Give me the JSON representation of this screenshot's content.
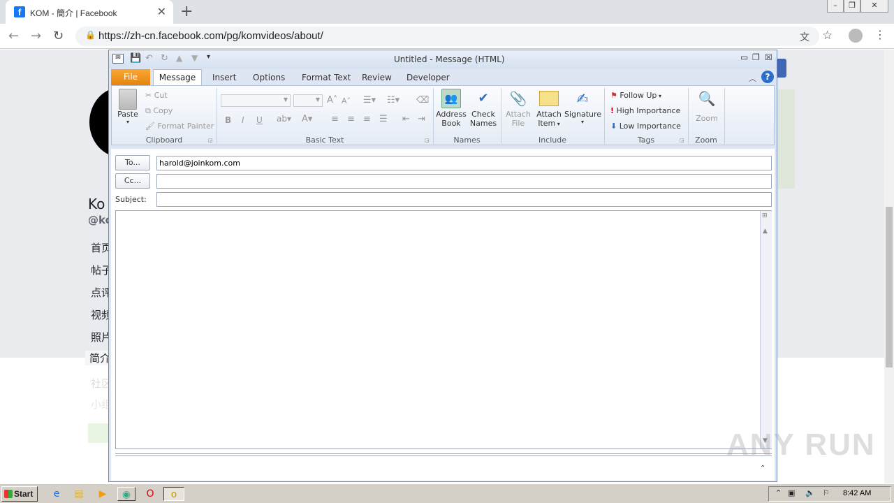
{
  "browser": {
    "tab_title": "KOM - 簡介 | Facebook",
    "tab_favicon": "f",
    "url": "https://zh-cn.facebook.com/pg/komvideos/about/"
  },
  "facebook": {
    "name_partial": "Ko",
    "handle_partial": "@ko",
    "nav": [
      "首页",
      "帖子",
      "点评",
      "视频",
      "照片",
      "简介",
      "社区",
      "小组"
    ]
  },
  "outlook": {
    "title": "Untitled  -  Message (HTML)",
    "tabs": {
      "file": "File",
      "message": "Message",
      "insert": "Insert",
      "options": "Options",
      "format_text": "Format Text",
      "review": "Review",
      "developer": "Developer"
    },
    "clipboard": {
      "paste": "Paste",
      "cut": "Cut",
      "copy": "Copy",
      "format_painter": "Format Painter",
      "label": "Clipboard"
    },
    "basic_text_label": "Basic Text",
    "names": {
      "address_book_1": "Address",
      "address_book_2": "Book",
      "check_names_1": "Check",
      "check_names_2": "Names",
      "label": "Names"
    },
    "include": {
      "attach_file_1": "Attach",
      "attach_file_2": "File",
      "attach_item_1": "Attach",
      "attach_item_2": "Item",
      "signature": "Signature",
      "label": "Include"
    },
    "tags": {
      "follow_up": "Follow Up",
      "high": "High Importance",
      "low": "Low Importance",
      "label": "Tags"
    },
    "zoom": {
      "button": "Zoom",
      "label": "Zoom"
    },
    "to_btn": "To...",
    "cc_btn": "Cc...",
    "subject_label": "Subject:",
    "to_value": "harold@joinkom.com",
    "cc_value": "",
    "subject_value": ""
  },
  "taskbar": {
    "start": "Start",
    "clock": "8:42 AM"
  },
  "watermark": "ANY RUN"
}
